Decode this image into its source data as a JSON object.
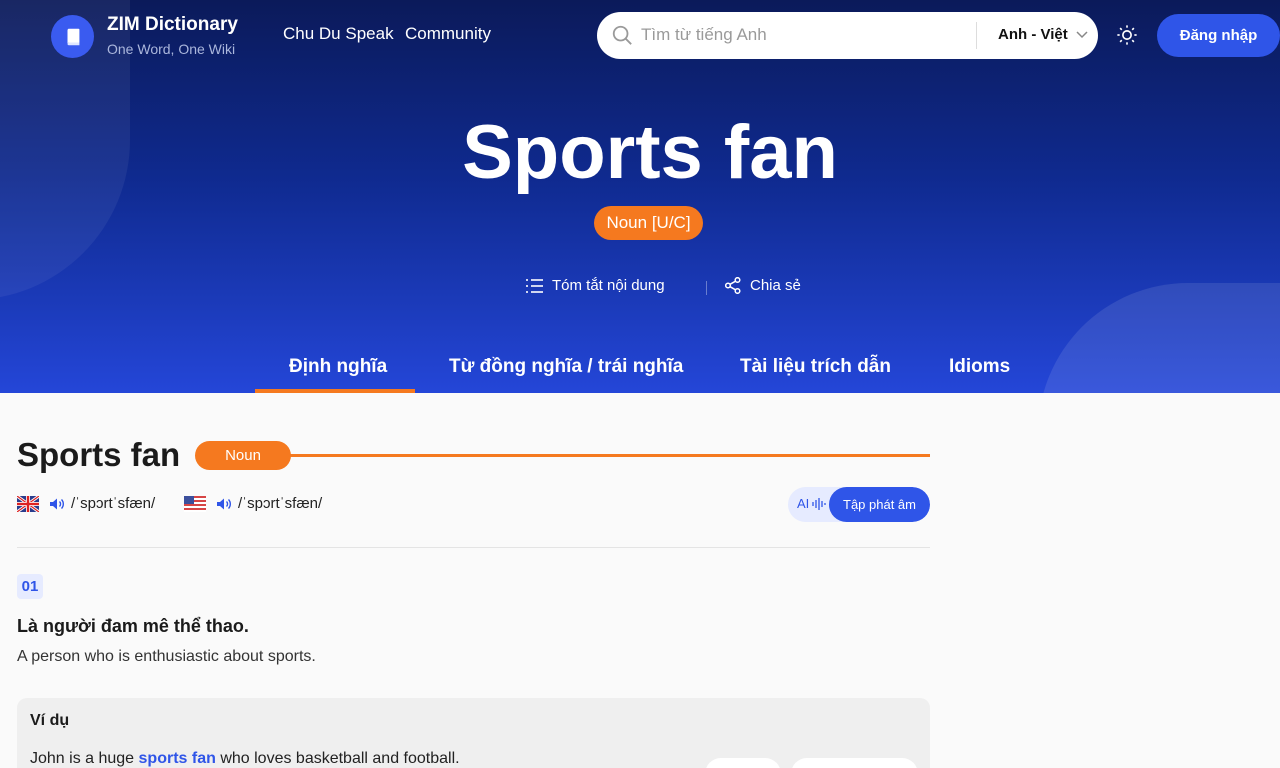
{
  "brand": {
    "name": "ZIM Dictionary",
    "tagline": "One Word, One Wiki"
  },
  "nav": {
    "items": [
      "Chu Du Speak",
      "Community"
    ]
  },
  "search": {
    "placeholder": "Tìm từ tiếng Anh",
    "language": "Anh - Việt"
  },
  "header": {
    "login_label": "Đăng nhập"
  },
  "hero": {
    "word": "Sports fan",
    "pos": "Noun [U/C]",
    "summary_label": "Tóm tắt nội dung",
    "share_label": "Chia sẻ"
  },
  "tabs": [
    {
      "label": "Định nghĩa",
      "active": true
    },
    {
      "label": "Từ đồng nghĩa / trái nghĩa",
      "active": false
    },
    {
      "label": "Tài liệu trích dẫn",
      "active": false
    },
    {
      "label": "Idioms",
      "active": false
    }
  ],
  "entry": {
    "word": "Sports fan",
    "pos": "Noun",
    "pron_uk": "/ˈspɔrtˈsfæn/",
    "pron_us": "/ˈspɔrtˈsfæn/",
    "ai_label": "AI",
    "practice_label": "Tập phát âm",
    "senses": [
      {
        "number": "01",
        "definition_vi": "Là người đam mê thể thao.",
        "definition_en": "A person who is enthusiastic about sports.",
        "example_heading": "Ví dụ",
        "example_before": "John is a huge ",
        "example_highlight": "sports fan",
        "example_after": " who loves basketball and football."
      }
    ]
  },
  "colors": {
    "accent": "#f5791f",
    "primary": "#2f55e8",
    "hero_top": "#0b1a5a",
    "hero_bottom": "#2446d8"
  }
}
